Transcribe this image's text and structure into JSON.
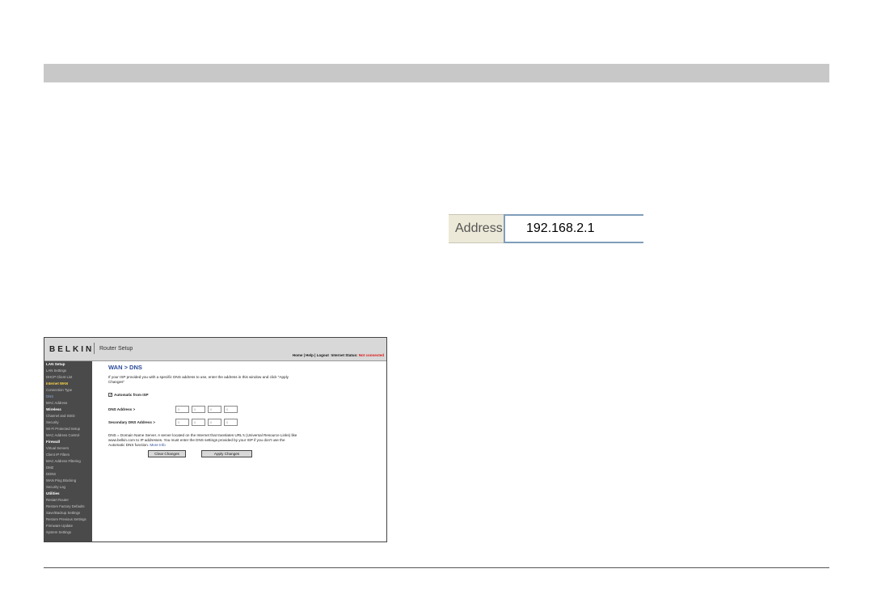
{
  "address_bar": {
    "label": "Address",
    "value": "192.168.2.1"
  },
  "router": {
    "logo": "BELKIN",
    "app_title": "Router Setup",
    "top_links": {
      "home": "Home",
      "help": "Help",
      "logout": "Logout",
      "status_label": "Internet Status:",
      "status_value": "Not connected"
    },
    "sidebar": [
      {
        "label": "LAN Setup",
        "kind": "hd"
      },
      {
        "label": "LAN Settings",
        "kind": "item"
      },
      {
        "label": "DHCP Client List",
        "kind": "item"
      },
      {
        "label": "Internet WAN",
        "kind": "active"
      },
      {
        "label": "Connection Type",
        "kind": "item"
      },
      {
        "label": "DNS",
        "kind": "sub"
      },
      {
        "label": "MAC Address",
        "kind": "item"
      },
      {
        "label": "Wireless",
        "kind": "hd"
      },
      {
        "label": "Channel and SSID",
        "kind": "item"
      },
      {
        "label": "Security",
        "kind": "item"
      },
      {
        "label": "Wi-Fi Protected Setup",
        "kind": "item"
      },
      {
        "label": "MAC Address Control",
        "kind": "item"
      },
      {
        "label": "Firewall",
        "kind": "hd"
      },
      {
        "label": "Virtual Servers",
        "kind": "item"
      },
      {
        "label": "Client IP Filters",
        "kind": "item"
      },
      {
        "label": "MAC Address Filtering",
        "kind": "item"
      },
      {
        "label": "DMZ",
        "kind": "item"
      },
      {
        "label": "DDNS",
        "kind": "item"
      },
      {
        "label": "WAN Ping Blocking",
        "kind": "item"
      },
      {
        "label": "Security Log",
        "kind": "item"
      },
      {
        "label": "Utilities",
        "kind": "hd"
      },
      {
        "label": "Restart Router",
        "kind": "item"
      },
      {
        "label": "Restore Factory Defaults",
        "kind": "item"
      },
      {
        "label": "Save/Backup Settings",
        "kind": "item"
      },
      {
        "label": "Restore Previous Settings",
        "kind": "item"
      },
      {
        "label": "Firmware Update",
        "kind": "item"
      },
      {
        "label": "System Settings",
        "kind": "item"
      }
    ],
    "page_title": "WAN > DNS",
    "intro": "If your ISP provided you with a specific DNS address to use, enter the address in this window and click \"Apply Changes\"",
    "auto_label": "Automatic from ISP",
    "auto_checked": true,
    "dns_label": "DNS Address >",
    "secondary_dns_label": "Secondary DNS Address >",
    "dns_octets": [
      "0",
      "0",
      "0",
      "0"
    ],
    "secondary_dns_octets": [
      "0",
      "0",
      "0",
      "0"
    ],
    "note": "DNS = Domain Name Server. A server located on the Internet that translates URL's (Universal Resource Links) like www.belkin.com to IP addresses. You must enter the DNS settings provided by your ISP if you don't use the Automatic DNS function.",
    "more_info": "More Info",
    "clear_button": "Clear Changes",
    "apply_button": "Apply Changes"
  }
}
